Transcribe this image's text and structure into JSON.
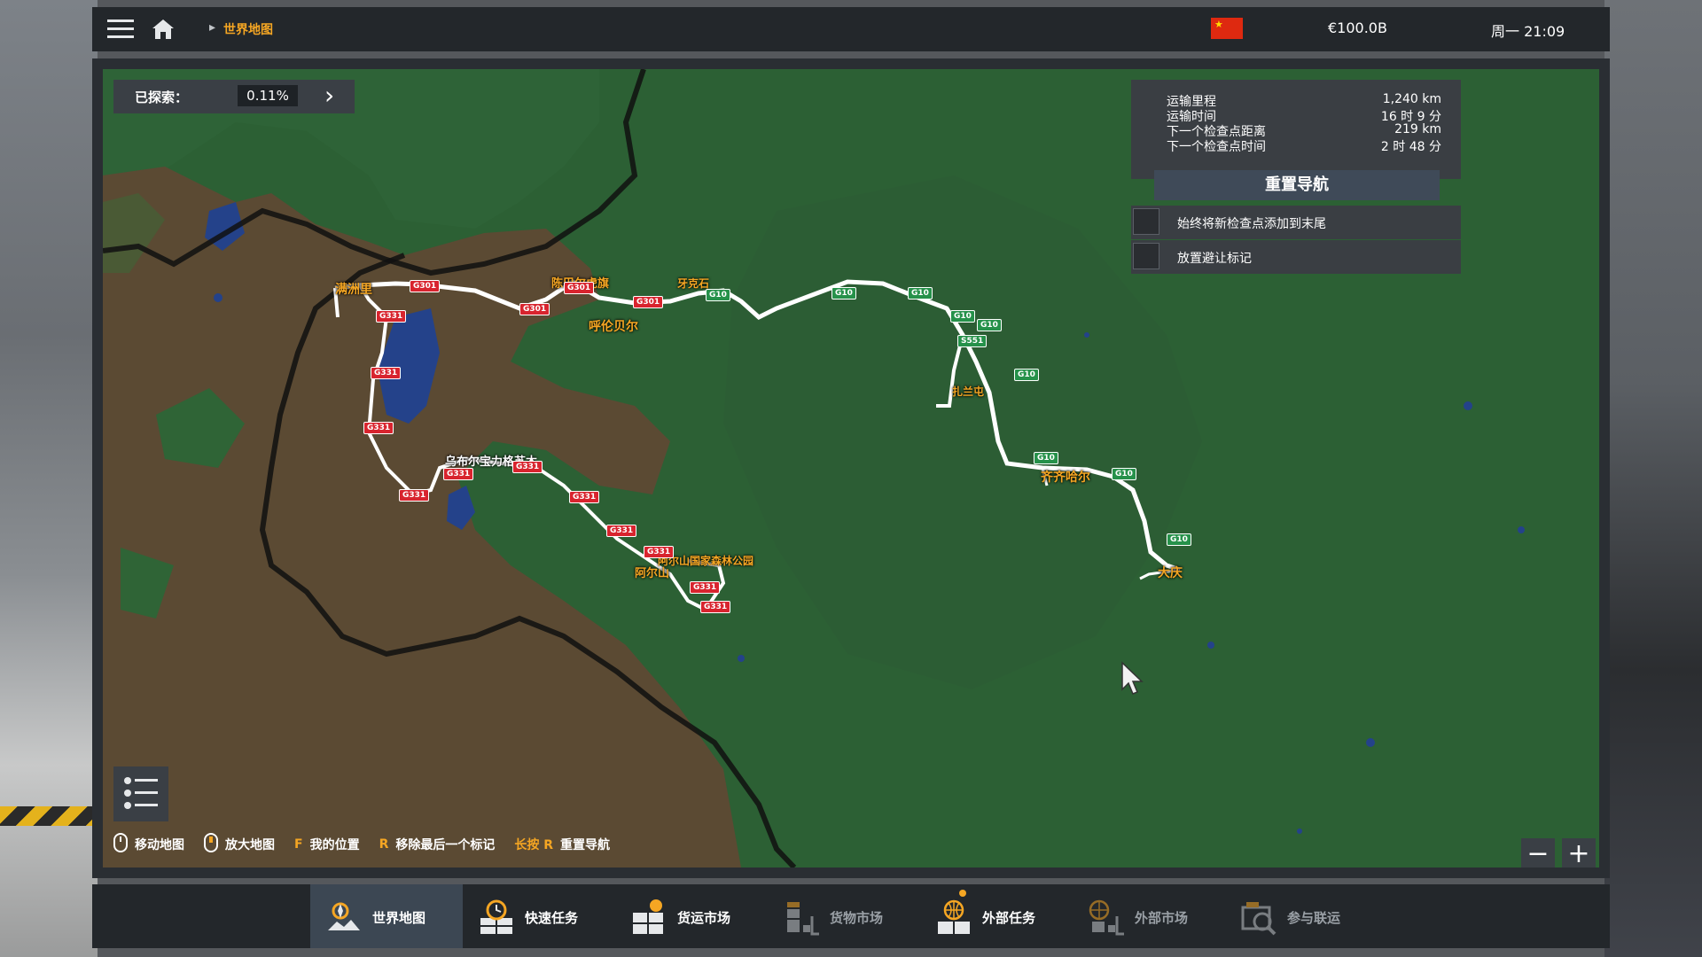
{
  "top_bar": {
    "breadcrumb": "世界地图",
    "money": "€100.0B",
    "clock": "周一 21:09"
  },
  "explored": {
    "label": "已探索：",
    "value": "0.11%"
  },
  "route_info": {
    "rows": [
      {
        "label": "运输里程",
        "value": "1,240 km"
      },
      {
        "label": "运输时间",
        "value": "16 时 9 分"
      },
      {
        "label": "下一个检查点距离",
        "value": "219 km"
      },
      {
        "label": "下一个检查点时间",
        "value": "2 时 48 分"
      }
    ],
    "reset_button": "重置导航"
  },
  "options": {
    "always_add_checkpoint": "始终将新检查点添加到末尾",
    "place_avoid_marker": "放置避让标记"
  },
  "hints": [
    {
      "key": "",
      "text": "移动地图"
    },
    {
      "key": "",
      "text": "放大地图"
    },
    {
      "key": "F",
      "text": "我的位置"
    },
    {
      "key": "R",
      "text": "移除最后一个标记"
    },
    {
      "key": "长按 R",
      "text": "重置导航"
    }
  ],
  "zoom": {
    "minus": "−",
    "plus": "+"
  },
  "map": {
    "cities": [
      {
        "name": "满洲里"
      },
      {
        "name": "陈巴尔虎旗"
      },
      {
        "name": "呼伦贝尔"
      },
      {
        "name": "牙克石"
      },
      {
        "name": "扎兰屯"
      },
      {
        "name": "齐齐哈尔"
      },
      {
        "name": "大庆"
      },
      {
        "name": "乌布尔宝力格苏木"
      },
      {
        "name": "阿尔山国家森林公园"
      },
      {
        "name": "阿尔山"
      }
    ],
    "roads": [
      "G301",
      "G331",
      "G10",
      "S551"
    ]
  },
  "tabs": [
    {
      "label": "世界地图",
      "state": "active"
    },
    {
      "label": "快速任务",
      "state": "normal"
    },
    {
      "label": "货运市场",
      "state": "normal"
    },
    {
      "label": "货物市场",
      "state": "disabled"
    },
    {
      "label": "外部任务",
      "state": "normal"
    },
    {
      "label": "外部市场",
      "state": "disabled"
    },
    {
      "label": "参与联运",
      "state": "disabled"
    }
  ],
  "colors": {
    "accent": "#f5a623",
    "map_forest": "#2b5f33",
    "map_steppe": "#5b4a32",
    "route": "#ffffff"
  }
}
